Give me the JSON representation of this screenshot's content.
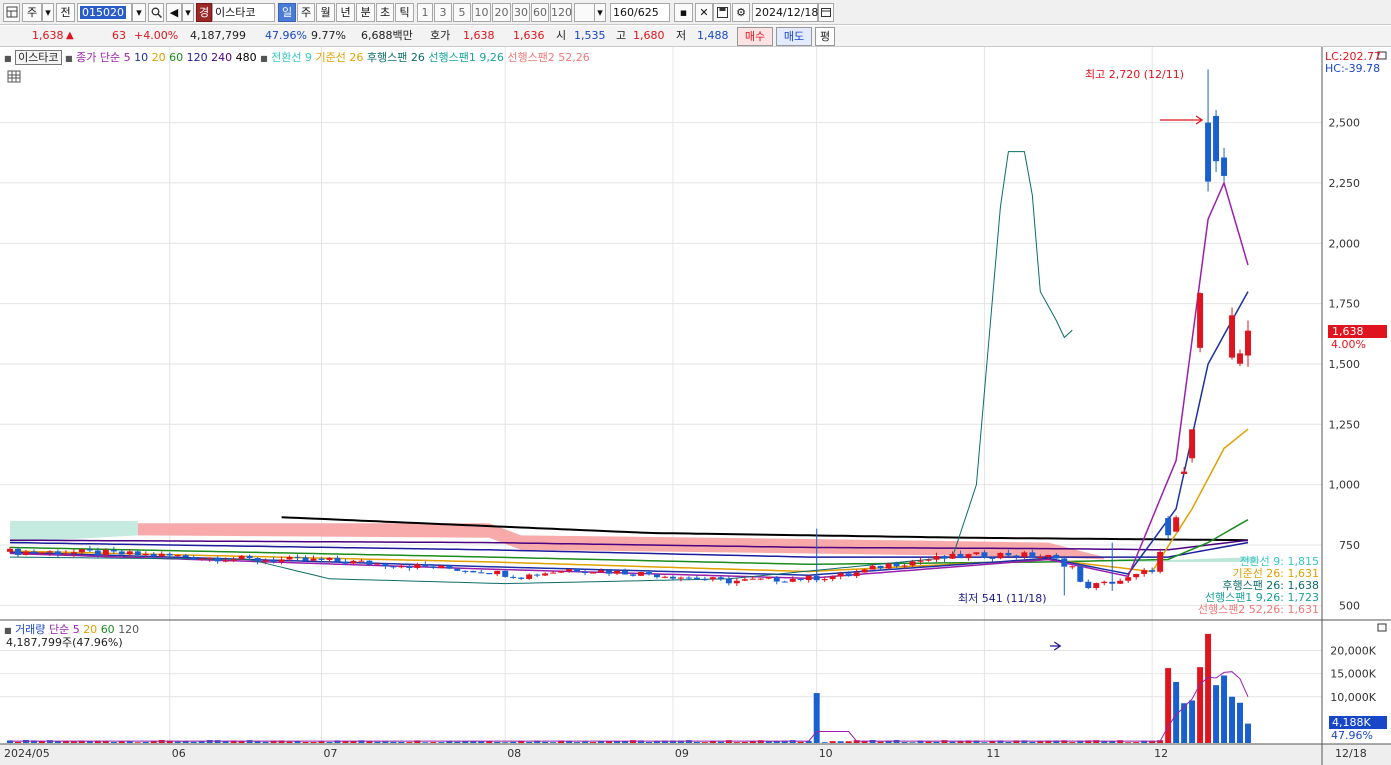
{
  "toolbar": {
    "type_label": "주",
    "prev_label": "전",
    "code": "015020",
    "brand_icon_label": "경",
    "stock_name": "이스타코",
    "periods": [
      "일",
      "주",
      "월",
      "년",
      "분",
      "초",
      "틱"
    ],
    "active_period": "일",
    "intervals": [
      "1",
      "3",
      "5",
      "10",
      "20",
      "30",
      "60",
      "120"
    ],
    "count": "160",
    "total": "/625",
    "date": "2024/12/18"
  },
  "quote": {
    "price": "1,638",
    "arrow": "▲",
    "change": "63",
    "change_pct": "+4.00%",
    "volume": "4,187,799",
    "vol_ratio": "47.96%",
    "turnover": "9.77%",
    "amount": "6,688백만",
    "hoga_label": "호가",
    "ask": "1,638",
    "bid": "1,636",
    "open_label": "시",
    "open": "1,535",
    "high_label": "고",
    "high": "1,680",
    "low_label": "저",
    "low": "1,488",
    "buy_label": "매수",
    "sell_label": "매도",
    "eval_label": "평"
  },
  "legend": {
    "name": "이스타코",
    "ma_prefix": "종가 단순",
    "ma_periods": [
      "5",
      "10",
      "20",
      "60",
      "120",
      "240",
      "480"
    ],
    "ma_colors": [
      "#9a1fae",
      "#1c31a3",
      "#e0a000",
      "#1c8c1c",
      "#1c1c9c",
      "#4b0082",
      "#000000"
    ],
    "ichimoku": [
      {
        "text": "전환선 9",
        "color": "#37c7c7"
      },
      {
        "text": "기준선 26",
        "color": "#e0a000"
      },
      {
        "text": "후행스팬 26",
        "color": "#0d6b6b"
      },
      {
        "text": "선행스팬1 9,26",
        "color": "#18a19a"
      },
      {
        "text": "선행스팬2 52,26",
        "color": "#f07878"
      }
    ],
    "lc": "LC:202.77",
    "hc": "HC:-39.78"
  },
  "annotations": {
    "high": "최고 2,720 (12/11)",
    "low": "최저 541 (11/18)",
    "cur_price": "1,638",
    "cur_pct": "4.00%",
    "tags": [
      {
        "text": "전환선 9: 1,815",
        "color": "#37c7c7"
      },
      {
        "text": "기준선 26: 1,631",
        "color": "#e0a000"
      },
      {
        "text": "후행스팬 26: 1,638",
        "color": "#0d6b6b"
      },
      {
        "text": "선행스팬1 9,26: 1,723",
        "color": "#18a19a"
      },
      {
        "text": "선행스팬2 52,26: 1,631",
        "color": "#f07878"
      }
    ]
  },
  "volume_legend": {
    "label": "거래량",
    "ma_prefix": "단순",
    "ma_periods": [
      "5",
      "20",
      "60",
      "120"
    ],
    "ma_colors": [
      "#9a1fae",
      "#e0a000",
      "#1c8c1c",
      "#555555"
    ],
    "detail": "4,187,799주(47.96%)",
    "cur_vol": "4,188K",
    "cur_pct": "47.96%"
  },
  "chart_data": {
    "type": "candlestick",
    "price_axis": {
      "ticks": [
        500,
        750,
        1000,
        1250,
        1500,
        1750,
        2000,
        2250,
        2500
      ],
      "tick_labels": [
        "500",
        "750",
        "1,000",
        "1,250",
        "1,500",
        "1,750",
        "2,000",
        "2,250",
        "2,500"
      ],
      "range": [
        460,
        2780
      ]
    },
    "volume_axis": {
      "ticks": [
        10000,
        15000,
        20000
      ],
      "tick_labels": [
        "10,000K",
        "15,000K",
        "20,000K"
      ],
      "range": [
        0,
        24000
      ]
    },
    "x_labels": [
      {
        "label": "2024/05",
        "index": 0
      },
      {
        "label": "06",
        "index": 20
      },
      {
        "label": "07",
        "index": 39
      },
      {
        "label": "08",
        "index": 62
      },
      {
        "label": "09",
        "index": 83
      },
      {
        "label": "10",
        "index": 101
      },
      {
        "label": "11",
        "index": 122
      },
      {
        "label": "12",
        "index": 143
      },
      {
        "label": "12/18",
        "index": 155
      }
    ],
    "bars": 156,
    "anchors": [
      [
        0,
        722
      ],
      [
        10,
        718
      ],
      [
        20,
        705
      ],
      [
        30,
        690
      ],
      [
        40,
        685
      ],
      [
        50,
        665
      ],
      [
        60,
        640
      ],
      [
        64,
        620
      ],
      [
        70,
        650
      ],
      [
        80,
        630
      ],
      [
        90,
        600
      ],
      [
        100,
        612
      ],
      [
        105,
        625
      ],
      [
        110,
        670
      ],
      [
        115,
        690
      ],
      [
        120,
        705
      ],
      [
        125,
        712
      ],
      [
        130,
        700
      ],
      [
        133,
        660
      ],
      [
        134,
        590
      ],
      [
        135,
        580
      ],
      [
        137,
        590
      ],
      [
        140,
        610
      ],
      [
        143,
        650
      ],
      [
        145,
        780
      ],
      [
        146,
        850
      ],
      [
        147,
        1050
      ],
      [
        148,
        1230
      ],
      [
        150,
        2300
      ],
      [
        151,
        2380
      ],
      [
        152,
        2260
      ],
      [
        153,
        1700
      ],
      [
        154,
        1520
      ],
      [
        155,
        1638
      ]
    ],
    "spikes": [
      {
        "index": 101,
        "high": 818,
        "low": 595
      },
      {
        "index": 138,
        "high": 760,
        "low": 560
      }
    ],
    "high_point": {
      "index": 150,
      "value": 2720,
      "label": "12/11"
    },
    "low_point": {
      "index": 132,
      "value": 541,
      "label": "11/18"
    },
    "volume_spikes": [
      {
        "index": 101,
        "value": 10800,
        "up": false
      },
      {
        "index": 145,
        "value": 16200,
        "up": true
      },
      {
        "index": 146,
        "value": 13200,
        "up": false
      },
      {
        "index": 147,
        "value": 8600,
        "up": false
      },
      {
        "index": 148,
        "value": 9200,
        "up": false
      },
      {
        "index": 149,
        "value": 16400,
        "up": true
      },
      {
        "index": 150,
        "value": 23600,
        "up": true
      },
      {
        "index": 151,
        "value": 12500,
        "up": false
      },
      {
        "index": 152,
        "value": 14600,
        "up": false
      },
      {
        "index": 153,
        "value": 10000,
        "up": false
      },
      {
        "index": 154,
        "value": 8700,
        "up": false
      },
      {
        "index": 155,
        "value": 4188,
        "up": false
      }
    ],
    "ma_lines": {
      "ma5": [
        [
          0,
          715
        ],
        [
          60,
          650
        ],
        [
          100,
          612
        ],
        [
          130,
          690
        ],
        [
          140,
          620
        ],
        [
          146,
          1100
        ],
        [
          150,
          2100
        ],
        [
          152,
          2250
        ],
        [
          155,
          1910
        ]
      ],
      "ma10": [
        [
          0,
          720
        ],
        [
          60,
          660
        ],
        [
          100,
          625
        ],
        [
          130,
          695
        ],
        [
          140,
          630
        ],
        [
          146,
          900
        ],
        [
          150,
          1500
        ],
        [
          155,
          1800
        ]
      ],
      "ma20": [
        [
          0,
          725
        ],
        [
          60,
          680
        ],
        [
          100,
          640
        ],
        [
          130,
          690
        ],
        [
          143,
          640
        ],
        [
          148,
          900
        ],
        [
          152,
          1150
        ],
        [
          155,
          1230
        ]
      ],
      "ma60": [
        [
          0,
          740
        ],
        [
          60,
          700
        ],
        [
          100,
          670
        ],
        [
          130,
          680
        ],
        [
          145,
          690
        ],
        [
          150,
          760
        ],
        [
          155,
          855
        ]
      ],
      "ma120": [
        [
          0,
          760
        ],
        [
          60,
          730
        ],
        [
          100,
          700
        ],
        [
          130,
          700
        ],
        [
          145,
          700
        ],
        [
          155,
          760
        ]
      ],
      "ma240": [
        [
          0,
          770
        ],
        [
          60,
          760
        ],
        [
          100,
          740
        ],
        [
          130,
          735
        ],
        [
          145,
          730
        ],
        [
          155,
          770
        ]
      ],
      "ma480": [
        [
          34,
          865
        ],
        [
          80,
          800
        ],
        [
          120,
          780
        ],
        [
          155,
          770
        ]
      ]
    },
    "chikou": [
      [
        0,
        700
      ],
      [
        30,
        690
      ],
      [
        40,
        610
      ],
      [
        62,
        590
      ],
      [
        90,
        610
      ],
      [
        118,
        700
      ],
      [
        121,
        1000
      ],
      [
        124,
        2150
      ],
      [
        125,
        2380
      ],
      [
        127,
        2380
      ],
      [
        128,
        2200
      ],
      [
        129,
        1800
      ],
      [
        131,
        1680
      ],
      [
        132,
        1610
      ],
      [
        133,
        1640
      ]
    ]
  }
}
